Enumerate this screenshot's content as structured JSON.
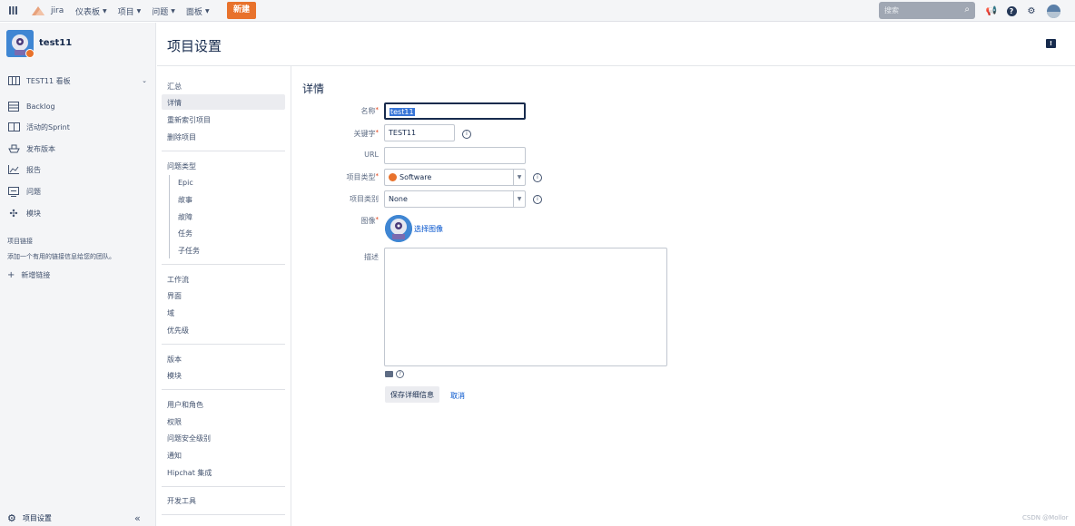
{
  "topbar": {
    "menu_icon": "app-switcher-icon",
    "logo": "jira",
    "nav": [
      "仪表板",
      "项目",
      "问题",
      "面板"
    ],
    "create_label": "新建",
    "search_placeholder": "搜索"
  },
  "sidebar": {
    "project_name": "test11",
    "items": [
      {
        "label": "TEST11 看板",
        "icon": "board-icon"
      },
      {
        "label": "Backlog",
        "icon": "backlog-icon"
      },
      {
        "label": "活动的Sprint",
        "icon": "sprint-icon"
      },
      {
        "label": "发布版本",
        "icon": "ship-icon"
      },
      {
        "label": "报告",
        "icon": "chart-icon"
      },
      {
        "label": "问题",
        "icon": "issues-icon"
      },
      {
        "label": "模块",
        "icon": "puzzle-icon"
      }
    ],
    "links_title": "项目链接",
    "links_desc": "添加一个有用的链接信息给您的团队。",
    "add_link": "新增链接",
    "settings_label": "项目设置"
  },
  "page": {
    "title": "项目设置",
    "section_title": "详情"
  },
  "subnav": {
    "group1": [
      "汇总",
      "详情",
      "重新索引项目",
      "删除项目"
    ],
    "group2_title": "问题类型",
    "group2": [
      "Epic",
      "故事",
      "故障",
      "任务",
      "子任务"
    ],
    "group3": [
      "工作流",
      "界面",
      "域",
      "优先级"
    ],
    "group4": [
      "版本",
      "模块"
    ],
    "group5": [
      "用户和角色",
      "权限",
      "问题安全级别",
      "通知",
      "Hipchat 集成"
    ],
    "group6": [
      "开发工具"
    ]
  },
  "form": {
    "name_label": "名称",
    "name_value": "test11",
    "key_label": "关键字",
    "key_value": "TEST11",
    "url_label": "URL",
    "url_value": "",
    "type_label": "项目类型",
    "type_value": "Software",
    "category_label": "项目类别",
    "category_value": "None",
    "avatar_label": "图像",
    "avatar_link": "选择图像",
    "desc_label": "描述",
    "save_label": "保存详细信息",
    "cancel_label": "取消"
  },
  "watermark": "CSDN @Mollor"
}
